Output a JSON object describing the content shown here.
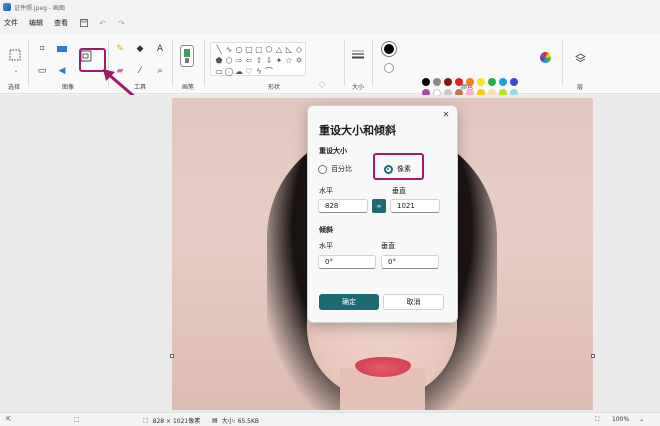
{
  "window": {
    "title": "证件照.jpeg - 画图"
  },
  "menu": {
    "items": [
      "文件",
      "编辑",
      "查看"
    ]
  },
  "ribbon": {
    "groups": {
      "selection": "选择",
      "image": "图像",
      "tools": "工具",
      "brushes": "画笔",
      "shapes": "形状",
      "size": "大小",
      "colors": "颜色",
      "layers": "层"
    },
    "palette_colors": [
      "#000000",
      "#8a8a8a",
      "#7a1a1a",
      "#e0242a",
      "#f37c22",
      "#f5e61c",
      "#22b14c",
      "#1aa2e8",
      "#3f48cc",
      "#a349a4",
      "#ffffff",
      "#c8c8c8",
      "#b97a57",
      "#ffaec9",
      "#ffc90e",
      "#efe4b0",
      "#b5e61d",
      "#99d9ea",
      "#7092be",
      "#c8bfe7"
    ]
  },
  "dialog": {
    "title": "重设大小和倾斜",
    "resize_label": "重设大小",
    "option_percent": "百分比",
    "option_pixels": "像素",
    "horizontal_label": "水平",
    "vertical_label": "垂直",
    "width_value": "828",
    "height_value": "1021",
    "skew_label": "倾斜",
    "skew_horizontal_label": "水平",
    "skew_vertical_label": "垂直",
    "skew_h_value": "0°",
    "skew_v_value": "0°",
    "ok": "确定",
    "cancel": "取消",
    "link_icon": "∞"
  },
  "status": {
    "dimensions": "828 × 1021像素",
    "file_size": "大小: 65.5KB",
    "zoom": "100%"
  }
}
